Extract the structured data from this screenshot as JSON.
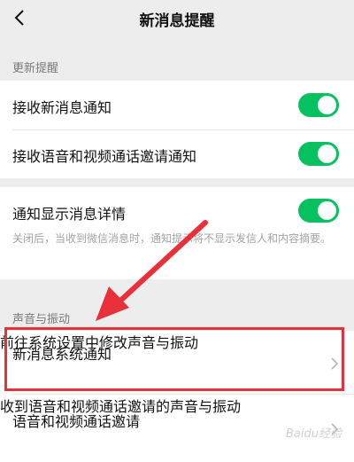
{
  "header": {
    "title": "新消息提醒",
    "back_icon": "chevron-left-icon"
  },
  "sections": {
    "updates_label": "更新提醒",
    "sound_label": "声音与振动"
  },
  "items": {
    "receive_new": "接收新消息通知",
    "receive_call": "接收语音和视频通话邀请通知",
    "show_detail": "通知显示消息详情",
    "show_detail_desc": "关闭后，当收到微信消息时，通知提示将不显示发信人和内容摘要。",
    "system_notify": "新消息系统通知",
    "system_notify_sub": "前往系统设置中修改声音与振动",
    "call_invite": "语音和视频通话邀请",
    "call_invite_sub": "收到语音和视频通话邀请的声音与振动"
  },
  "toggles": {
    "receive_new": true,
    "receive_call": true,
    "show_detail": true
  },
  "colors": {
    "accent": "#07c160",
    "highlight": "#e8303a"
  },
  "watermark": "Baidu经验"
}
